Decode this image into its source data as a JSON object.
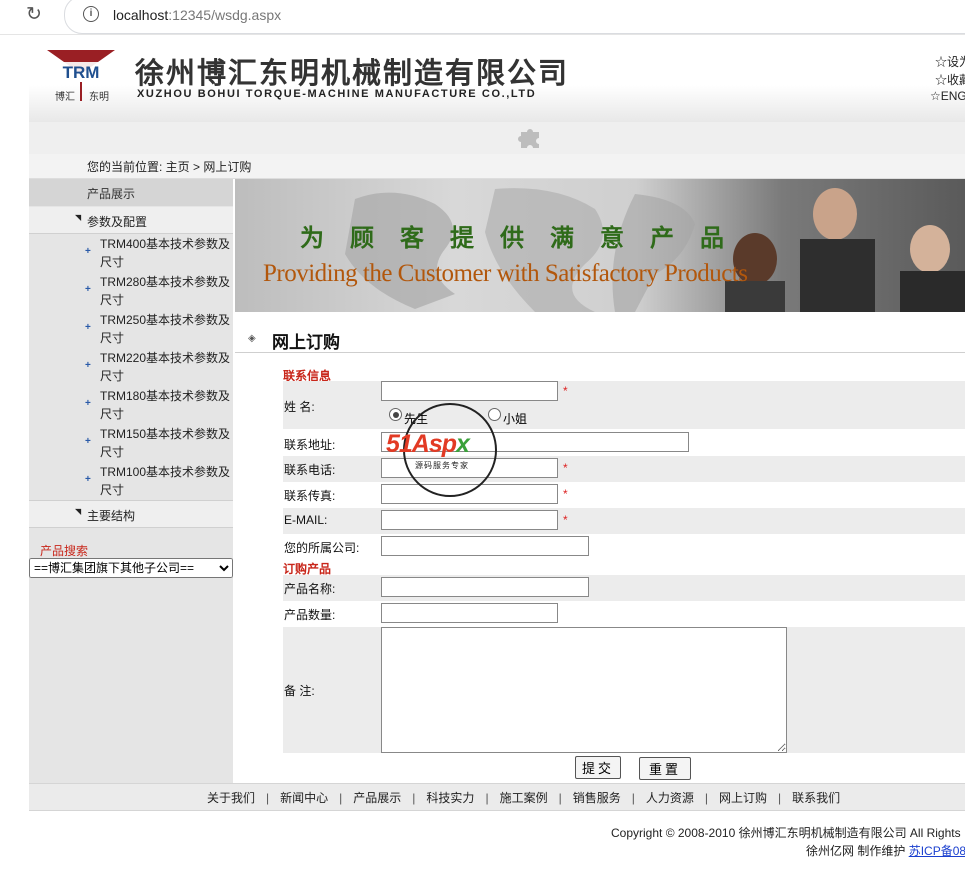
{
  "browser": {
    "url_host": "localhost",
    "url_path": ":12345/wsdg.aspx"
  },
  "header": {
    "logo_text": "TRM",
    "logo_sub_left": "博汇",
    "logo_sub_right": "东明",
    "company_cn": "徐州博汇东明机械制造有限公司",
    "company_en": "XUZHOU BOHUI TORQUE-MACHINE MANUFACTURE CO.,LTD",
    "top_links": [
      "☆设为",
      "☆收藏",
      "☆ENG"
    ]
  },
  "breadcrumb": "您的当前位置: 主页 > 网上订购",
  "sidebar": {
    "title": "产品展示",
    "category_params": "参数及配置",
    "items": [
      "TRM400基本技术参数及尺寸",
      "TRM280基本技术参数及尺寸",
      "TRM250基本技术参数及尺寸",
      "TRM220基本技术参数及尺寸",
      "TRM180基本技术参数及尺寸",
      "TRM150基本技术参数及尺寸",
      "TRM100基本技术参数及尺寸"
    ],
    "category_structure": "主要结构",
    "search_label": "产品搜索",
    "select_value": "==博汇集团旗下其他子公司=="
  },
  "banner": {
    "slogan_cn": "为顾客提供满意产品",
    "slogan_en": "Providing the Customer with Satisfactory Products"
  },
  "page_title": "网上订购",
  "form": {
    "contact_group": "联系信息",
    "name_label": "姓    名:",
    "gender_male": "先生",
    "gender_female": "小姐",
    "address_label": "联系地址:",
    "phone_label": "联系电话:",
    "fax_label": "联系传真:",
    "email_label": "E-MAIL:",
    "company_label": "您的所属公司:",
    "order_group": "订购产品",
    "product_name_label": "产品名称:",
    "product_qty_label": "产品数量:",
    "notes_label": "备    注:",
    "required_mark": "*",
    "submit_label": "提交",
    "reset_label": "重置"
  },
  "watermark": {
    "brand_main": "51Asp",
    "brand_x": "x",
    "brand_sub": "源码服务专家"
  },
  "footer": {
    "nav": [
      "关于我们",
      "新闻中心",
      "产品展示",
      "科技实力",
      "施工案例",
      "销售服务",
      "人力资源",
      "网上订购",
      "联系我们"
    ],
    "nav_separator": "|",
    "copyright": "Copyright © 2008-2010 徐州博汇东明机械制造有限公司 All Rights",
    "maintainer": "徐州亿网 制作维护",
    "icp": "苏ICP备08"
  },
  "colors": {
    "accent_red": "#c8261a",
    "banner_green": "#2f6b1a",
    "banner_orange": "#b2570c",
    "sidebar_bg": "#e5e5e5"
  }
}
